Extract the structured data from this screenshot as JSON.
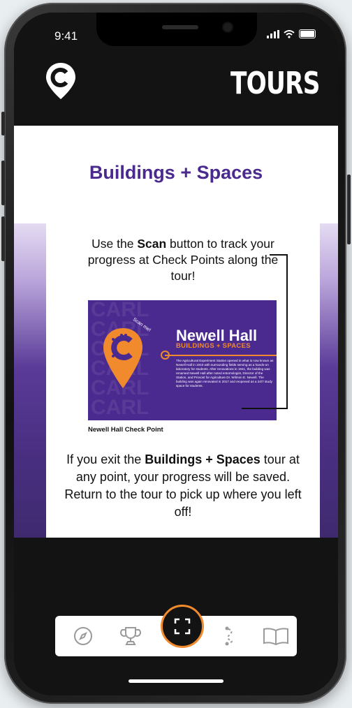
{
  "status_bar": {
    "time": "9:41"
  },
  "header": {
    "title": "TOURS"
  },
  "main": {
    "title": "Buildings + Spaces",
    "card": {
      "p1_a": "Use the ",
      "p1_b": "Scan",
      "p1_c": " button to track your progress at Check Points along the tour!",
      "preview": {
        "bg_word": "CARL",
        "scan_label": "Scan me!",
        "title": "Newell Hall",
        "subtitle": "BUILDINGS + SPACES",
        "body": "The Agricultural Experiment Station opened in what is now known as Newell Hall in 1910 with surrounding fields serving as a hands-on laboratory for students. After renovations in 1941, the building was renamed Newell Hall after noted entomologist, Director of the Station, and Provost for Agriculture Dr. Wilmon E. Newell. The building was again renovated in 2017 and reopened as a 24/7 study space for students."
      },
      "caption": "Newell Hall Check Point",
      "p2_a": "If you exit the ",
      "p2_b": "Buildings + Spaces",
      "p2_c": " tour at any point, your progress will be saved. Return to the tour to pick up where you left off!"
    },
    "pagination": {
      "count": 4,
      "active_index": 2
    }
  },
  "nav": {
    "items": [
      "compass-icon",
      "trophy-icon",
      "scan-icon",
      "route-icon",
      "book-icon"
    ]
  },
  "colors": {
    "purple": "#4b2a8f",
    "orange": "#f08a2c",
    "dark": "#131313"
  }
}
